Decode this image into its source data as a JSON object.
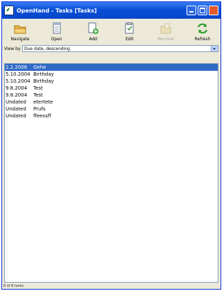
{
  "window": {
    "title": "OpenHand - Tasks [Tasks]"
  },
  "toolbar": [
    {
      "label": "Navigate",
      "icon": "folder-icon"
    },
    {
      "label": "Open",
      "icon": "document-icon"
    },
    {
      "label": "Add",
      "icon": "add-task-icon"
    },
    {
      "label": "Edit",
      "icon": "edit-icon"
    },
    {
      "label": "Recover",
      "icon": "recover-icon",
      "disabled": true
    },
    {
      "label": "Refresh",
      "icon": "refresh-icon"
    }
  ],
  "view": {
    "label": "View by",
    "selected": "Due date, descending"
  },
  "tasks": [
    {
      "date": "2.2.2006",
      "title": "Gehe",
      "selected": true
    },
    {
      "date": "5.10.2004",
      "title": "Birthday"
    },
    {
      "date": "5.10.2004",
      "title": "Birthday"
    },
    {
      "date": "9.8.2004",
      "title": "Test"
    },
    {
      "date": "9.8.2004",
      "title": "Test"
    },
    {
      "date": "Undated",
      "title": "etertete"
    },
    {
      "date": "Undated",
      "title": "Prufs"
    },
    {
      "date": "Undated",
      "title": "ffeessff"
    }
  ],
  "status": {
    "text": "8 of 8 tasks"
  },
  "colors": {
    "titlebar": "#0a4fd8",
    "selection": "#316ac5",
    "window_bg": "#ece9d8"
  }
}
